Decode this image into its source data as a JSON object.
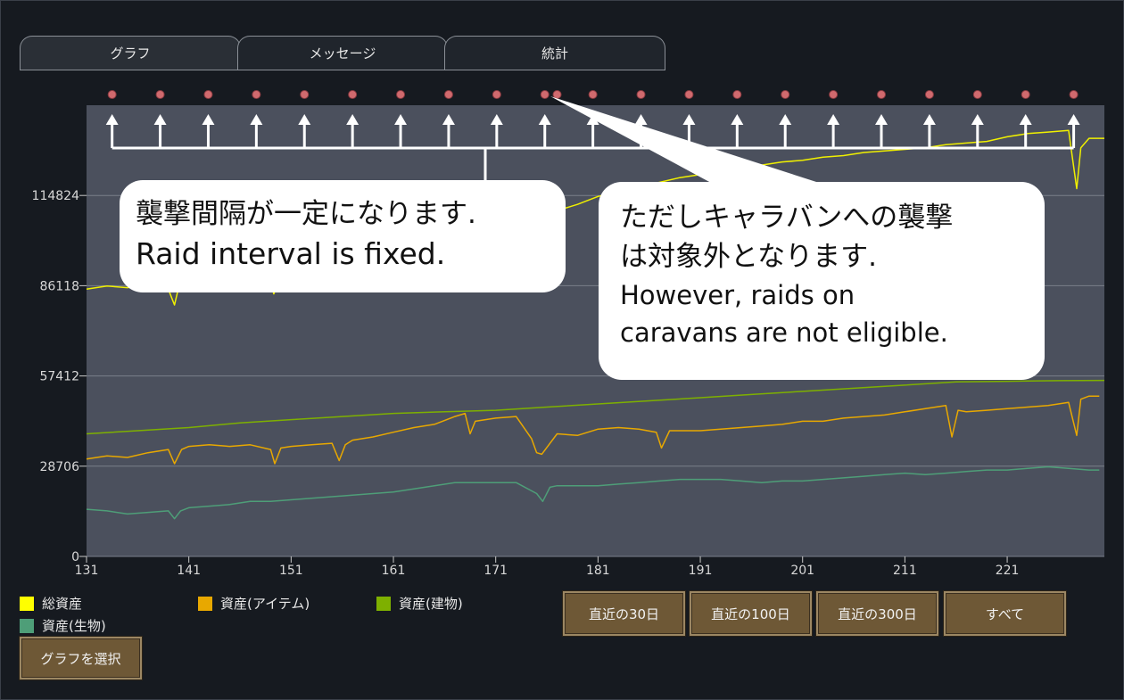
{
  "tabs": [
    {
      "label": "グラフ",
      "active": true
    },
    {
      "label": "メッセージ",
      "active": false
    },
    {
      "label": "統計",
      "active": false
    }
  ],
  "chart_data": {
    "type": "line",
    "x_ticks": [
      131,
      141,
      151,
      161,
      171,
      181,
      191,
      201,
      211,
      221
    ],
    "y_ticks": [
      0,
      28706,
      57412,
      86118,
      114824
    ],
    "xlim": [
      131,
      230.5
    ],
    "ylim": [
      0,
      143530
    ],
    "grid": true,
    "legend_position": "bottom-left",
    "series": [
      {
        "name": "総資産",
        "color": "#f0f000",
        "x": [
          131,
          133,
          135,
          137,
          139,
          139.6,
          140,
          141,
          143,
          145,
          147,
          149,
          149.3,
          149.7,
          151,
          153,
          155,
          157,
          159,
          161,
          163,
          165,
          167,
          169,
          171,
          173,
          175,
          177,
          179,
          181,
          183,
          185,
          187,
          189,
          191,
          193,
          195,
          197,
          199,
          201,
          203,
          205,
          207,
          209,
          211,
          213,
          215,
          217,
          219,
          221,
          223,
          225,
          227,
          227.8,
          228.2,
          229,
          230.5
        ],
        "values": [
          85000,
          86000,
          85500,
          86500,
          85000,
          80000,
          85500,
          86000,
          86500,
          87000,
          86500,
          87000,
          83500,
          86500,
          88000,
          88500,
          89000,
          89500,
          90000,
          91000,
          92000,
          93500,
          95500,
          98000,
          102000,
          104000,
          108000,
          110000,
          112000,
          114500,
          116000,
          117500,
          119000,
          120500,
          121500,
          122000,
          123000,
          124500,
          125500,
          126000,
          127000,
          127500,
          128500,
          129000,
          129500,
          130000,
          131000,
          131500,
          132000,
          133500,
          134500,
          135000,
          135500,
          117000,
          130000,
          133000,
          133000
        ]
      },
      {
        "name": "資産(アイテム)",
        "color": "#e8a800",
        "x": [
          131,
          133,
          135,
          137,
          139,
          139.6,
          140.3,
          141,
          143,
          145,
          147,
          149,
          149.4,
          150,
          151,
          153,
          155,
          155.7,
          156.3,
          157,
          159,
          161,
          163,
          165,
          167,
          168,
          168.5,
          169,
          171,
          173,
          174.5,
          175,
          175.5,
          177,
          179,
          181,
          183,
          185,
          186.7,
          187.2,
          188,
          191,
          193,
          195,
          197,
          199,
          201,
          203,
          205,
          207,
          209,
          211,
          213,
          215,
          215.6,
          216.2,
          217,
          219,
          221,
          223,
          225,
          227,
          227.8,
          228.2,
          229,
          230
        ],
        "values": [
          31000,
          32000,
          31500,
          33000,
          34000,
          29500,
          34000,
          35000,
          35500,
          35000,
          35500,
          34000,
          29500,
          34500,
          35000,
          35500,
          36000,
          30500,
          35500,
          37000,
          38000,
          39500,
          41000,
          42000,
          44500,
          45500,
          39000,
          43000,
          44000,
          44500,
          37500,
          33000,
          32500,
          39000,
          38500,
          40500,
          41000,
          40500,
          39500,
          34500,
          40000,
          40000,
          40500,
          41000,
          41500,
          42000,
          43000,
          43000,
          44000,
          44500,
          45000,
          46000,
          47000,
          48000,
          38000,
          46500,
          46000,
          46500,
          47000,
          47500,
          48000,
          49000,
          38500,
          50000,
          51000,
          51000
        ]
      },
      {
        "name": "資産(建物)",
        "color": "#7eb000",
        "x": [
          131,
          136,
          141,
          146,
          151,
          156,
          161,
          166,
          171,
          176,
          181,
          186,
          191,
          196,
          201,
          206,
          211,
          216,
          221,
          226,
          230.5
        ],
        "values": [
          39000,
          40000,
          41000,
          42500,
          43500,
          44500,
          45500,
          46000,
          46500,
          47500,
          48500,
          49500,
          50500,
          51500,
          52500,
          53500,
          54500,
          55500,
          55700,
          55900,
          56000
        ]
      },
      {
        "name": "資産(生物)",
        "color": "#4e9e78",
        "x": [
          131,
          133,
          135,
          137,
          139,
          139.6,
          140.2,
          141,
          143,
          145,
          147,
          149,
          151,
          153,
          155,
          157,
          159,
          161,
          163,
          165,
          167,
          169,
          171,
          173,
          175,
          175.6,
          176.3,
          177,
          179,
          181,
          183,
          185,
          187,
          189,
          191,
          193,
          195,
          197,
          199,
          201,
          203,
          205,
          207,
          209,
          211,
          213,
          215,
          217,
          219,
          221,
          223,
          225,
          227,
          229,
          230
        ],
        "values": [
          15000,
          14500,
          13500,
          14000,
          14500,
          12000,
          14500,
          15500,
          16000,
          16500,
          17500,
          17500,
          18000,
          18500,
          19000,
          19500,
          20000,
          20500,
          21500,
          22500,
          23500,
          23500,
          23500,
          23500,
          20000,
          17500,
          22000,
          22500,
          22500,
          22500,
          23000,
          23500,
          24000,
          24500,
          24500,
          24500,
          24000,
          23500,
          24000,
          24000,
          24500,
          25000,
          25500,
          26000,
          26500,
          26000,
          26500,
          27000,
          27500,
          27500,
          28000,
          28500,
          28000,
          27500,
          27500
        ]
      }
    ],
    "event_markers": [
      133.5,
      138.2,
      142.9,
      147.6,
      152.3,
      157,
      161.7,
      166.4,
      171.1,
      175.8,
      177,
      180.5,
      185.2,
      189.9,
      194.6,
      199.3,
      204,
      208.7,
      213.4,
      218.1,
      222.8,
      227.5
    ]
  },
  "annotations": {
    "left_callout": {
      "line1": "襲撃間隔が一定になります.",
      "line2": "Raid interval is fixed."
    },
    "right_callout": {
      "line1": "ただしキャラバンへの襲撃",
      "line2": "は対象外となります.",
      "line3": "However, raids on",
      "line4": "caravans are not eligible."
    }
  },
  "legend": [
    {
      "label": "総資産",
      "color": "#ffff00"
    },
    {
      "label": "資産(アイテム)",
      "color": "#e8a800"
    },
    {
      "label": "資産(建物)",
      "color": "#7eb000"
    },
    {
      "label": "資産(生物)",
      "color": "#4e9e78"
    }
  ],
  "buttons": {
    "last30": "直近の30日",
    "last100": "直近の100日",
    "last300": "直近の300日",
    "all": "すべて",
    "select_graph": "グラフを選択"
  }
}
